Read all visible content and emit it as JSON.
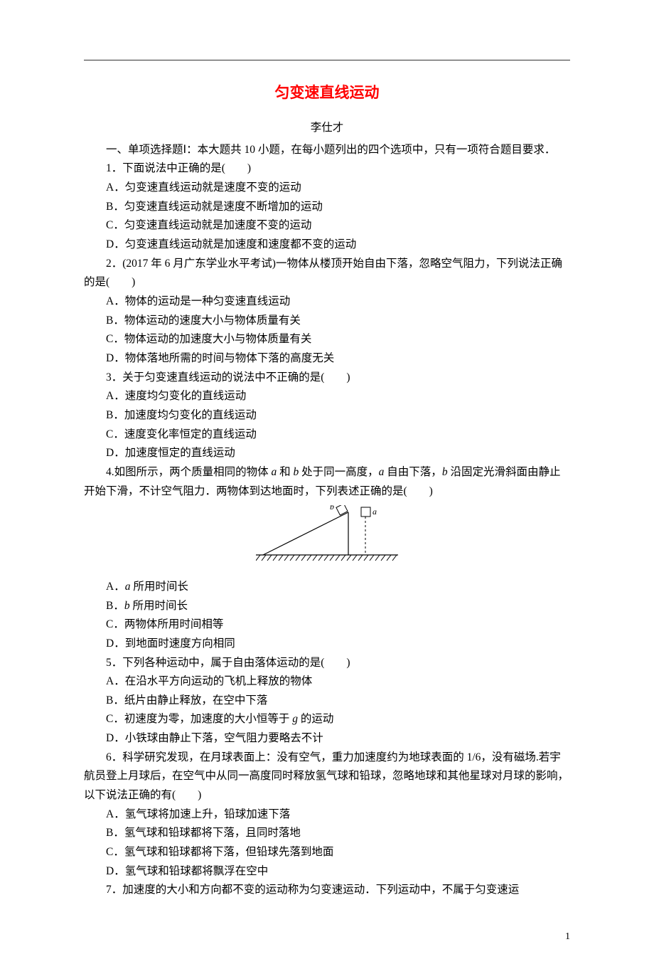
{
  "title": "匀变速直线运动",
  "author": "李仕才",
  "section1_intro": "一、单项选择题Ⅰ：本大题共 10 小题，在每小题列出的四个选项中，只有一项符合题目要求．",
  "q1": {
    "stem": "1．下面说法中正确的是(　　)",
    "A": "A．匀变速直线运动就是速度不变的运动",
    "B": "B．匀变速直线运动就是速度不断增加的运动",
    "C": "C．匀变速直线运动就是加速度不变的运动",
    "D": "D．匀变速直线运动就是加速度和速度都不变的运动"
  },
  "q2": {
    "stem": "2．(2017 年 6 月广东学业水平考试)一物体从楼顶开始自由下落，忽略空气阻力，下列说法正确的是(　　)",
    "A": "A．物体的运动是一种匀变速直线运动",
    "B": "B．物体运动的速度大小与物体质量有关",
    "C": "C．物体运动的加速度大小与物体质量有关",
    "D": "D．物体落地所需的时间与物体下落的高度无关"
  },
  "q3": {
    "stem": "3．关于匀变速直线运动的说法中不正确的是(　　)",
    "A": "A．速度均匀变化的直线运动",
    "B": "B．加速度均匀变化的直线运动",
    "C": "C．速度变化率恒定的直线运动",
    "D": "D．加速度恒定的直线运动"
  },
  "q4": {
    "stem_pre": "4.如图所示，两个质量相同的物体 ",
    "a": "a",
    "stem_mid1": " 和 ",
    "b": "b",
    "stem_mid2": " 处于同一高度，",
    "stem_mid3": " 自由下落，",
    "stem_mid4": " 沿固定光滑斜面由静止开始下滑，不计空气阻力．两物体到达地面时，下列表述正确的是(　　)",
    "A_pre": "A．",
    "A_post": " 所用时间长",
    "B_pre": "B．",
    "B_post": " 所用时间长",
    "C": "C．两物体所用时间相等",
    "D": "D．到地面时速度方向相同",
    "fig_b": "b",
    "fig_a": "a"
  },
  "q5": {
    "stem": "5．下列各种运动中，属于自由落体运动的是(　　)",
    "A": "A．在沿水平方向运动的飞机上释放的物体",
    "B": "B．纸片由静止释放，在空中下落",
    "C_pre": "C．初速度为零，加速度的大小恒等于 ",
    "g": "g",
    "C_post": " 的运动",
    "D": "D．小铁球由静止下落，空气阻力要略去不计"
  },
  "q6": {
    "stem": "6．科学研究发现，在月球表面上：没有空气，重力加速度约为地球表面的 1/6，没有磁场.若宇航员登上月球后，在空气中从同一高度同时释放氢气球和铅球，忽略地球和其他星球对月球的影响，以下说法正确的有(　　)",
    "A": "A．氢气球将加速上升，铅球加速下落",
    "B": "B．氢气球和铅球都将下落，且同时落地",
    "C": "C．氢气球和铅球都将下落，但铅球先落到地面",
    "D": "D．氢气球和铅球都将飘浮在空中"
  },
  "q7": {
    "stem": "7．加速度的大小和方向都不变的运动称为匀变速运动．下列运动中，不属于匀变速运"
  },
  "pagenum": "1"
}
